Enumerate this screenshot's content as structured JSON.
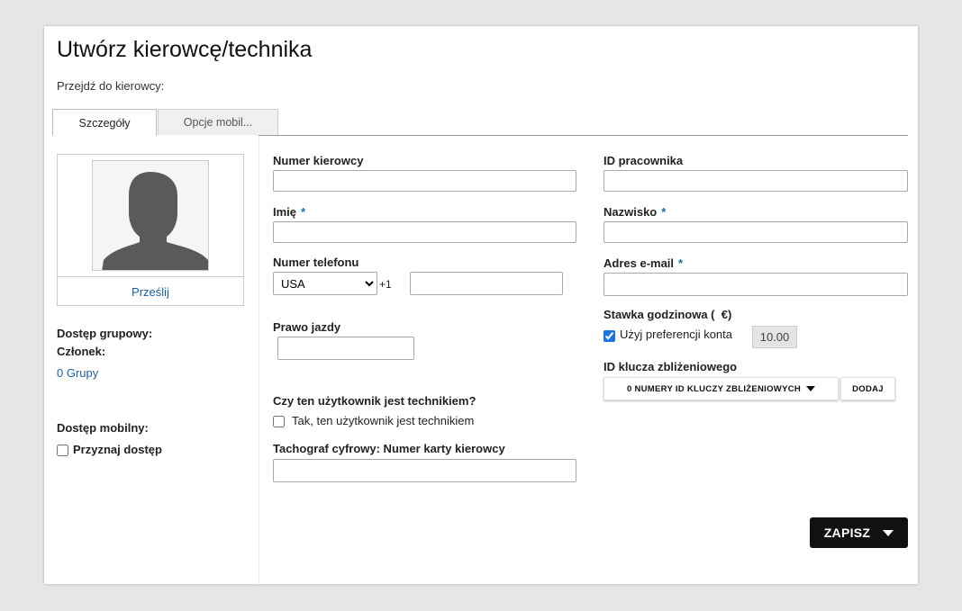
{
  "page": {
    "title": "Utwórz kierowcę/technika",
    "goto_label": "Przejdź do kierowcy:"
  },
  "tabs": [
    {
      "label": "Szczegóły",
      "active": true
    },
    {
      "label": "Opcje mobil...",
      "active": false
    }
  ],
  "sidebar": {
    "upload_label": "Prześlij",
    "group_access_label": "Dostęp grupowy:",
    "member_label": "Członek:",
    "groups_link": "0 Grupy",
    "mobile_access_label": "Dostęp mobilny:",
    "grant_access_label": "Przyznaj dostęp",
    "grant_access_checked": false
  },
  "form": {
    "driver_number": {
      "label": "Numer kierowcy",
      "value": ""
    },
    "employee_id": {
      "label": "ID pracownika",
      "value": ""
    },
    "first_name": {
      "label": "Imię",
      "required_mark": "*",
      "value": ""
    },
    "last_name": {
      "label": "Nazwisko",
      "required_mark": "*",
      "value": ""
    },
    "phone": {
      "label": "Numer telefonu",
      "country": "USA",
      "country_options": [
        "USA"
      ],
      "prefix": "+1",
      "value": ""
    },
    "email": {
      "label": "Adres e-mail",
      "required_mark": "*",
      "value": ""
    },
    "license": {
      "label": "Prawo jazdy",
      "value": ""
    },
    "hourly_rate": {
      "label": "Stawka godzinowa (  €)",
      "use_account_pref_label": "Użyj preferencji konta",
      "use_account_pref_checked": true,
      "value": "10.00"
    },
    "proximity": {
      "label": "ID klucza zbliżeniowego",
      "dropdown_label": "0 NUMERY ID KLUCZY ZBLIŻENIOWYCH",
      "add_label": "DODAJ"
    },
    "technician": {
      "question": "Czy ten użytkownik jest technikiem?",
      "checkbox_label": "Tak, ten użytkownik jest technikiem",
      "checked": false
    },
    "tachograph": {
      "label": "Tachograf cyfrowy: Numer karty kierowcy",
      "value": ""
    }
  },
  "actions": {
    "save_label": "ZAPISZ"
  },
  "colors": {
    "accent_link": "#1b5fa8",
    "required": "#1b6fb5",
    "save_button_bg": "#111111"
  }
}
